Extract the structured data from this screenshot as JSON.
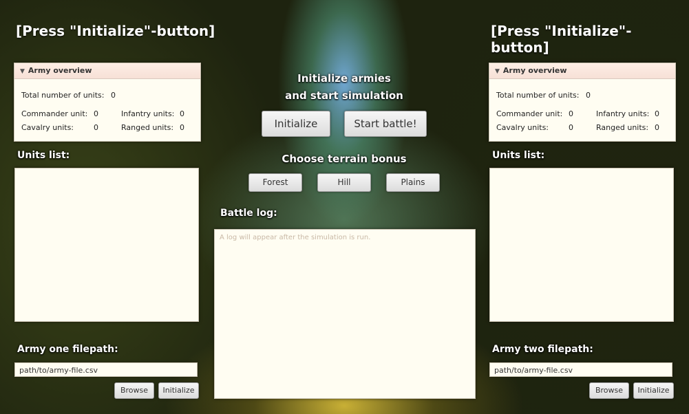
{
  "left": {
    "status_title": "[Press \"Initialize\"-button]",
    "overview": {
      "header": "Army overview",
      "total_label": "Total number of units:",
      "total_value": "0",
      "commander_label": "Commander unit:",
      "commander_value": "0",
      "infantry_label": "Infantry units:",
      "infantry_value": "0",
      "cavalry_label": "Cavalry units:",
      "cavalry_value": "0",
      "ranged_label": "Ranged units:",
      "ranged_value": "0"
    },
    "units_list_label": "Units list:",
    "filepath_label": "Army one filepath:",
    "filepath_value": "path/to/army-file.csv",
    "browse_label": "Browse",
    "initialize_label": "Initialize"
  },
  "right": {
    "status_title": "[Press \"Initialize\"-button]",
    "overview": {
      "header": "Army overview",
      "total_label": "Total number of units:",
      "total_value": "0",
      "commander_label": "Commander unit:",
      "commander_value": "0",
      "infantry_label": "Infantry units:",
      "infantry_value": "0",
      "cavalry_label": "Cavalry units:",
      "cavalry_value": "0",
      "ranged_label": "Ranged units:",
      "ranged_value": "0"
    },
    "units_list_label": "Units list:",
    "filepath_label": "Army two filepath:",
    "filepath_value": "path/to/army-file.csv",
    "browse_label": "Browse",
    "initialize_label": "Initialize"
  },
  "center": {
    "init_title_line1": "Initialize armies",
    "init_title_line2": "and start simulation",
    "initialize_button": "Initialize",
    "start_battle_button": "Start battle!",
    "terrain_title": "Choose terrain bonus",
    "terrain_forest": "Forest",
    "terrain_hill": "Hill",
    "terrain_plains": "Plains",
    "battle_log_label": "Battle log:",
    "battle_log_placeholder": "A log will appear after the simulation is run."
  },
  "colors": {
    "panel_bg": "#fffdf2",
    "header_bg": "#fdeee5",
    "label_text": "#ffffff"
  }
}
